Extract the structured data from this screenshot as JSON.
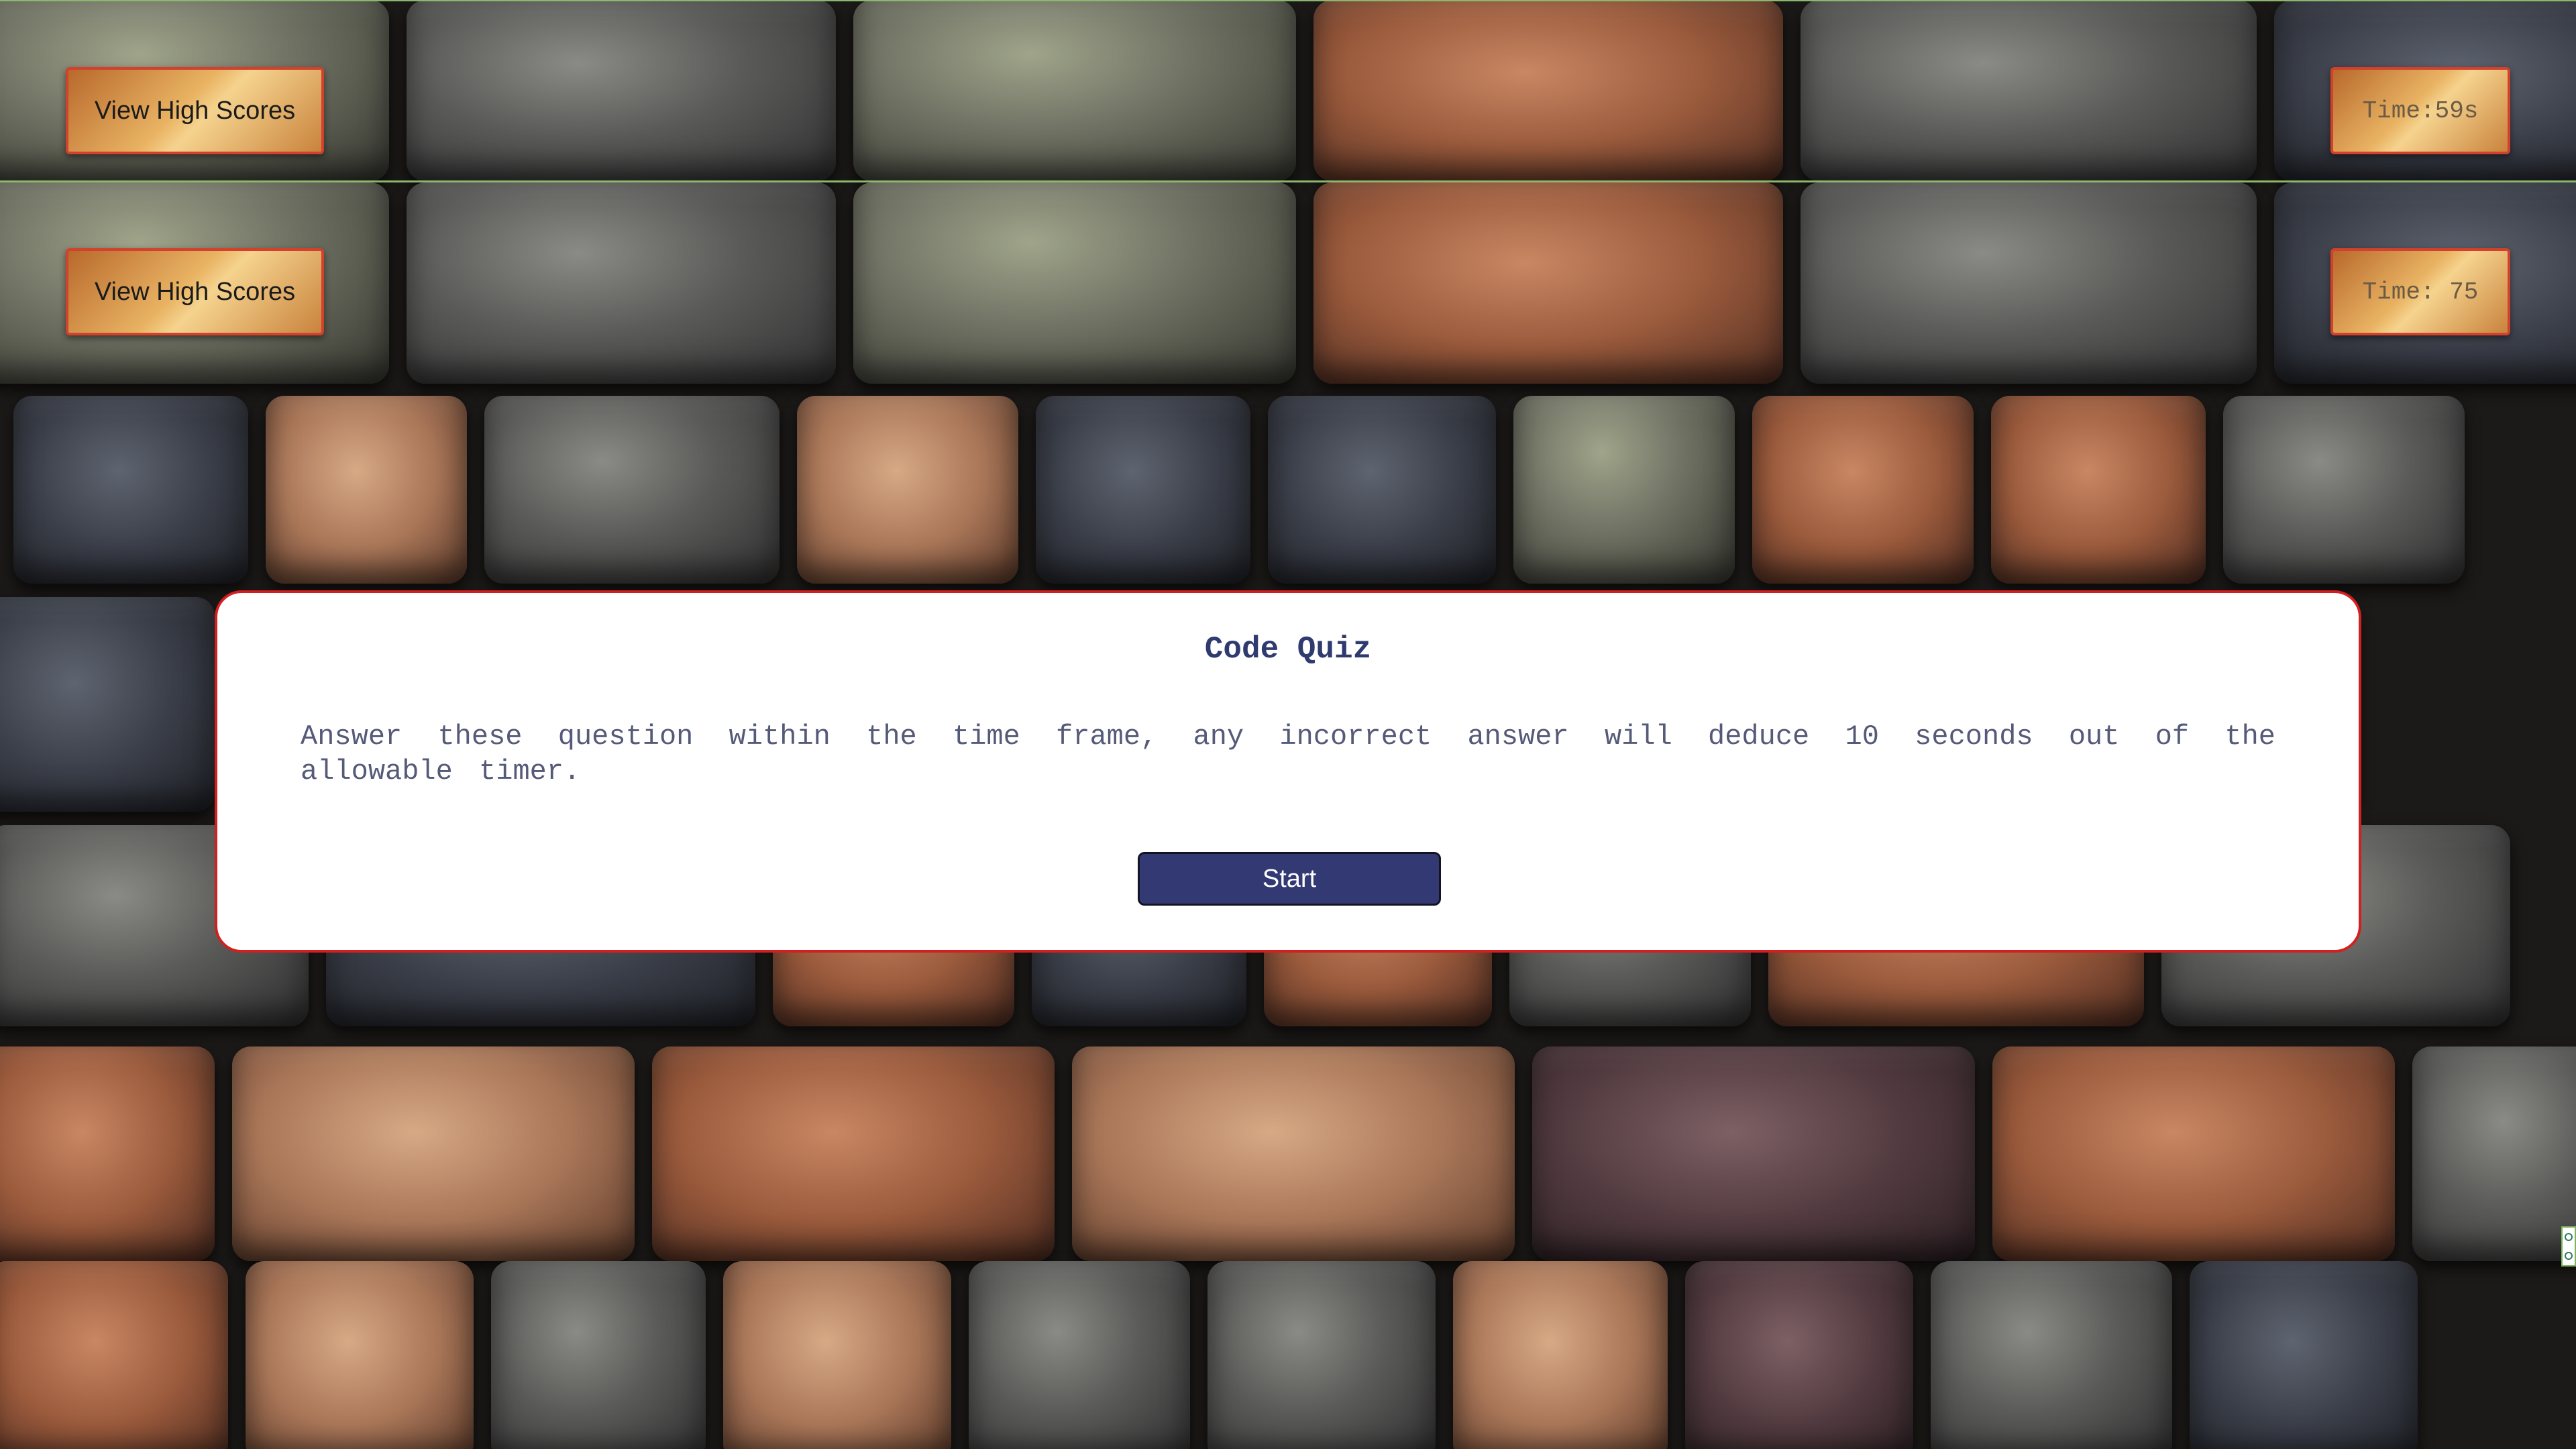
{
  "header_primary": {
    "high_scores_label": "View High Scores",
    "timer_text": "Time:59s"
  },
  "header_secondary": {
    "high_scores_label": "View High Scores",
    "timer_text": "Time: 75"
  },
  "quiz_card": {
    "title": "Code Quiz",
    "description": "Answer these question within the time frame, any incorrect answer will deduce 10 seconds out of the allowable timer.",
    "start_label": "Start"
  },
  "colors": {
    "accent_border": "#d2412c",
    "card_border": "#d21f1f",
    "start_button_bg": "#333a73",
    "title_color": "#2f3a6e",
    "header_divider": "#8db76c"
  },
  "icons": {
    "edge_widget": "scroll-control-icon"
  }
}
